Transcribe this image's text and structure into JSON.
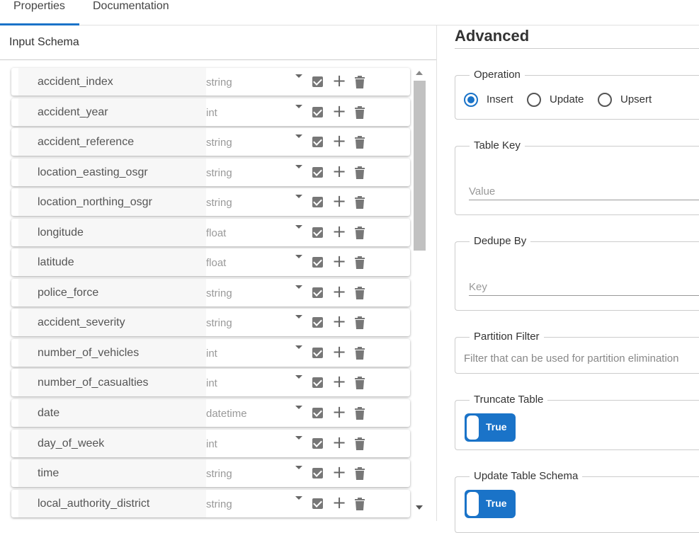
{
  "tabs": [
    {
      "label": "Properties",
      "active": true
    },
    {
      "label": "Documentation",
      "active": false
    }
  ],
  "input_schema": {
    "title": "Input Schema",
    "rows": [
      {
        "name": "accident_index",
        "type": "string"
      },
      {
        "name": "accident_year",
        "type": "int"
      },
      {
        "name": "accident_reference",
        "type": "string"
      },
      {
        "name": "location_easting_osgr",
        "type": "string"
      },
      {
        "name": "location_northing_osgr",
        "type": "string"
      },
      {
        "name": "longitude",
        "type": "float"
      },
      {
        "name": "latitude",
        "type": "float"
      },
      {
        "name": "police_force",
        "type": "string"
      },
      {
        "name": "accident_severity",
        "type": "string"
      },
      {
        "name": "number_of_vehicles",
        "type": "int"
      },
      {
        "name": "number_of_casualties",
        "type": "int"
      },
      {
        "name": "date",
        "type": "datetime"
      },
      {
        "name": "day_of_week",
        "type": "int"
      },
      {
        "name": "time",
        "type": "string"
      },
      {
        "name": "local_authority_district",
        "type": "string"
      }
    ]
  },
  "advanced": {
    "title": "Advanced",
    "operation": {
      "legend": "Operation",
      "options": [
        "Insert",
        "Update",
        "Upsert"
      ],
      "selected": "Insert"
    },
    "table_key": {
      "legend": "Table Key",
      "placeholder": "Value"
    },
    "dedupe_by": {
      "legend": "Dedupe By",
      "placeholder": "Key"
    },
    "partition_filter": {
      "legend": "Partition Filter",
      "placeholder": "Filter that can be used for partition elimination"
    },
    "truncate_table": {
      "legend": "Truncate Table",
      "value_label": "True"
    },
    "update_table_schema": {
      "legend": "Update Table Schema",
      "value_label": "True"
    }
  },
  "colors": {
    "accent": "#1a73c8"
  }
}
